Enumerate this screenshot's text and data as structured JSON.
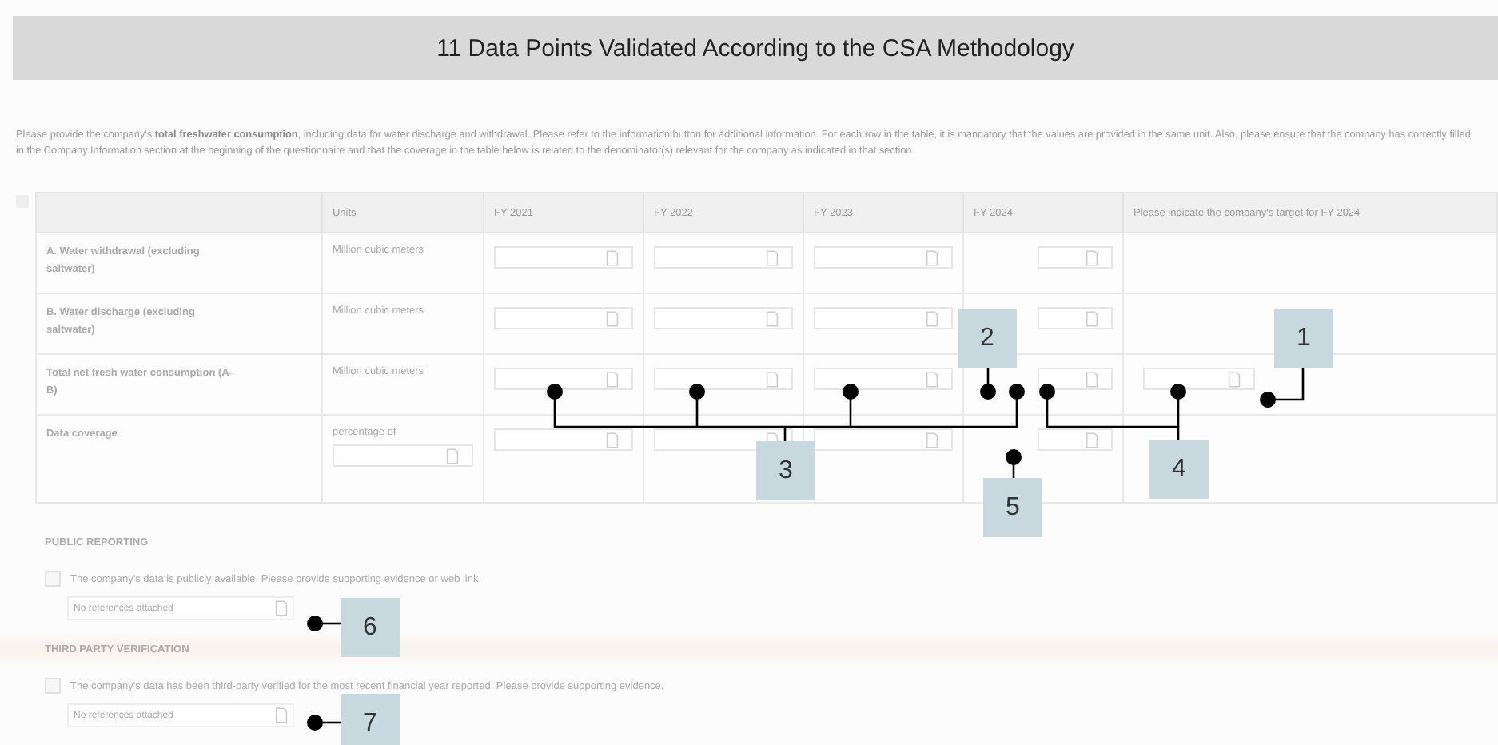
{
  "title": "11 Data Points Validated According to the CSA Methodology",
  "intro": "Please provide the company's **total freshwater consumption**, including data for water discharge and withdrawal. Please refer to the information button for additional information. For each row in the table, it is mandatory that the values are provided in the same unit. Also, please ensure that the company has correctly filled in the Company Information section at the beginning of the questionnaire and that the coverage in the table below is related to the denominator(s) relevant for the company as indicated in that section.",
  "table": {
    "columns": [
      "Units",
      "FY 2021",
      "FY 2022",
      "FY 2023",
      "FY 2024",
      "Please indicate the company's target for FY 2024"
    ],
    "rows": [
      {
        "label": "A. Water withdrawal (excluding saltwater)",
        "unit": "Million cubic meters",
        "unit_field": false,
        "target_field": false
      },
      {
        "label": "B. Water discharge (excluding saltwater)",
        "unit": "Million cubic meters",
        "unit_field": false,
        "target_field": false
      },
      {
        "label": "Total net fresh water consumption (A-B)",
        "unit": "Million cubic meters",
        "unit_field": false,
        "target_field": true
      },
      {
        "label": "Data coverage",
        "unit": "percentage of",
        "unit_field": true,
        "target_field": false
      }
    ]
  },
  "sections": [
    {
      "heading": "PUBLIC REPORTING",
      "statement": "The company's data is publicly available. Please provide supporting evidence or web link.",
      "checked": false,
      "attachment": "No references attached"
    },
    {
      "heading": "THIRD PARTY VERIFICATION",
      "statement": "The company's data has been third-party verified for the most recent financial year reported. Please provide supporting evidence.",
      "checked": false,
      "attachment": "No references attached"
    }
  ],
  "callouts": [
    "1",
    "2",
    "3",
    "4",
    "5",
    "6",
    "7"
  ]
}
